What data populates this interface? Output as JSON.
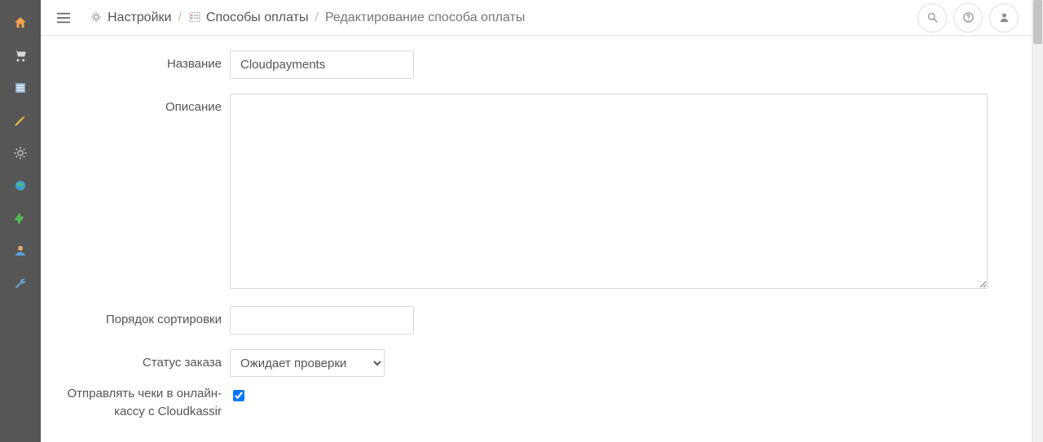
{
  "breadcrumb": {
    "settings": "Настройки",
    "payments": "Способы оплаты",
    "current": "Редактирование способа оплаты"
  },
  "form": {
    "name_label": "Название",
    "name_value": "Cloudpayments",
    "desc_label": "Описание",
    "desc_value": "",
    "sort_label": "Порядок сортировки",
    "sort_value": "",
    "status_label": "Статус заказа",
    "status_value": "Ожидает проверки",
    "sendcheck_label": "Отправлять чеки в онлайн-кассу с Cloudkassir",
    "sendcheck_checked": true
  },
  "sidebar_icons": [
    "home",
    "cart",
    "list",
    "pencil",
    "gear",
    "globe",
    "puzzle",
    "user",
    "wrench"
  ],
  "topbar_icons": [
    "search",
    "help",
    "user"
  ]
}
